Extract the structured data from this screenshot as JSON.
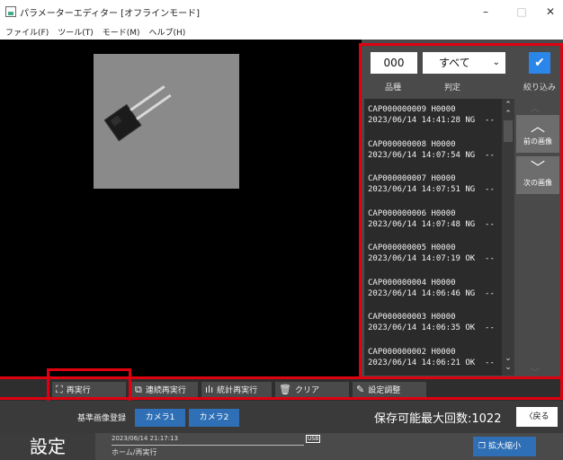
{
  "window": {
    "title": "パラメーターエディター [オフラインモード]",
    "minimize": "–",
    "maximize": "□",
    "close": "✕"
  },
  "menu": [
    "ファイル(F)",
    "ツール(T)",
    "モード(M)",
    "ヘルプ(H)"
  ],
  "panel": {
    "count": "000",
    "filter": "すべて",
    "filter_chevron": "⌄",
    "checkbox": "✔",
    "hdr_type": "品種",
    "hdr_judge": "判定",
    "hdr_narrow": "絞り込み",
    "rows": [
      "CAP000000009 H0000\n2023/06/14 14:41:28 NG  --",
      "CAP000000008 H0000\n2023/06/14 14:07:54 NG  --",
      "CAP000000007 H0000\n2023/06/14 14:07:51 NG  --",
      "CAP000000006 H0000\n2023/06/14 14:07:48 NG  --",
      "CAP000000005 H0000\n2023/06/14 14:07:19 OK  --",
      "CAP000000004 H0000\n2023/06/14 14:06:46 NG  --",
      "CAP000000003 H0000\n2023/06/14 14:06:35 OK  --",
      "CAP000000002 H0000\n2023/06/14 14:06:21 OK  --"
    ],
    "prev_label": "前の画像",
    "next_label": "次の画像"
  },
  "toolbar": {
    "rerun": "再実行",
    "cont_rerun": "連続再実行",
    "stat_rerun": "統計再実行",
    "clear": "クリア",
    "settings": "設定調整"
  },
  "status": {
    "ref_label": "基準画像登録",
    "camera1": "カメラ1",
    "camera2": "カメラ2",
    "max_count": "保存可能最大回数:1022",
    "back": "戻る"
  },
  "bottom": {
    "title": "設定",
    "time": "2023/06/14 21:17:13",
    "crumb": "ホーム/再実行",
    "badge": "USB",
    "zoom": "拡大縮小"
  },
  "colors": {
    "accent": "#2f6fb5",
    "highlight": "#e00010",
    "check": "#2a86e8"
  }
}
